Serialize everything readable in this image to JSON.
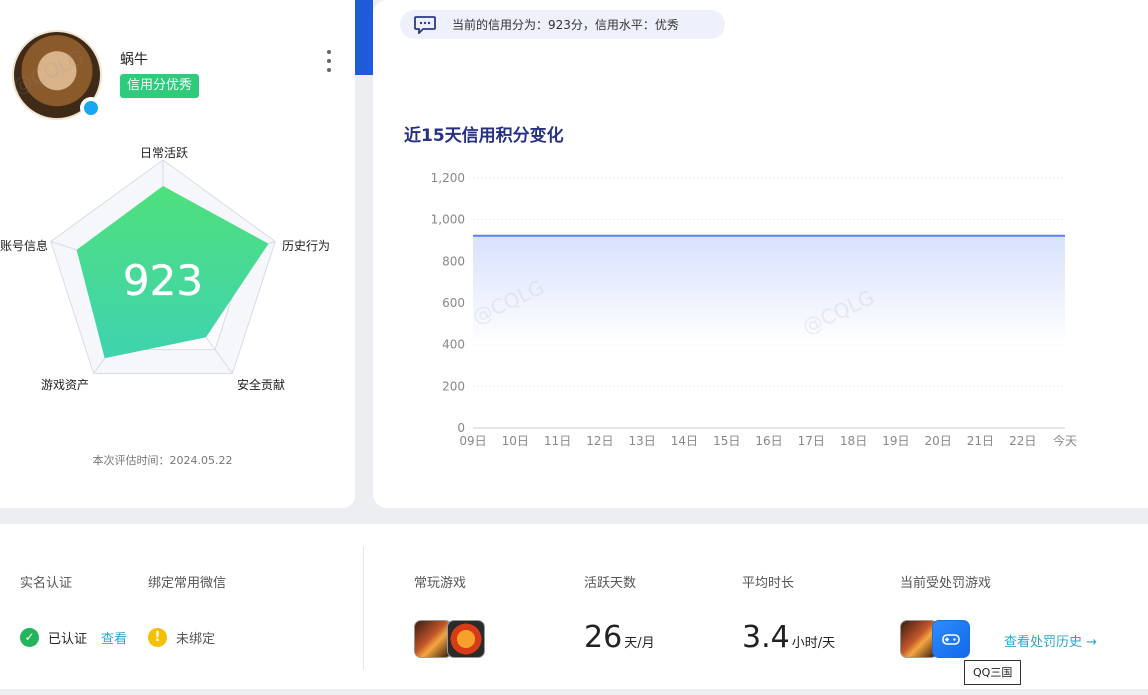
{
  "profile": {
    "username": "蜗牛",
    "credit_tag": "信用分优秀",
    "radar": {
      "score": "923",
      "dimensions": [
        "日常活跃",
        "历史行为",
        "安全贡献",
        "游戏资产",
        "账号信息"
      ],
      "levels": [
        0.78,
        0.94,
        0.62,
        0.84,
        0.77
      ]
    },
    "eval_time": "本次评估时间：2024.05.22"
  },
  "notice": {
    "text": "当前的信用分为：923分，信用水平：优秀"
  },
  "chart": {
    "title": "近15天信用积分变化"
  },
  "chart_data": {
    "type": "area",
    "title": "近15天信用积分变化",
    "xlabel": "",
    "ylabel": "",
    "categories": [
      "09日",
      "10日",
      "11日",
      "12日",
      "13日",
      "14日",
      "15日",
      "16日",
      "17日",
      "18日",
      "19日",
      "20日",
      "21日",
      "22日",
      "今天"
    ],
    "values": [
      923,
      923,
      923,
      923,
      923,
      923,
      923,
      923,
      923,
      923,
      923,
      923,
      923,
      923,
      923
    ],
    "ylim": [
      0,
      1200
    ],
    "yticks": [
      "0",
      "200",
      "400",
      "600",
      "800",
      "1,000",
      "1,200"
    ],
    "grid": true,
    "line_color": "#5b82e8",
    "fill_color": "#dfe6fd"
  },
  "stats": {
    "realname": {
      "label": "实名认证",
      "status": "已认证",
      "link": "查看"
    },
    "wechat": {
      "label": "绑定常用微信",
      "status": "未绑定"
    },
    "games": {
      "label": "常玩游戏"
    },
    "active_days": {
      "label": "活跃天数",
      "value": "26",
      "unit": "天/月"
    },
    "avg_time": {
      "label": "平均时长",
      "value": "3.4",
      "unit": "小时/天"
    },
    "punished": {
      "label": "当前受处罚游戏",
      "link": "查看处罚历史 →",
      "tooltip": "QQ三国"
    }
  },
  "colors": {
    "accent_blue": "#1d5bd8",
    "green": "#2dcb7b",
    "link": "#2aa5c9",
    "title": "#273184"
  }
}
